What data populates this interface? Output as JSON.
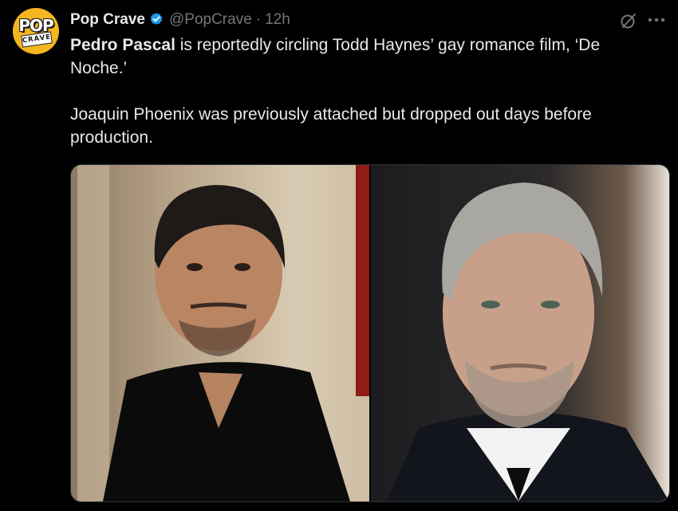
{
  "account": {
    "display_name": "Pop Crave",
    "handle": "@PopCrave",
    "separator": "·",
    "time": "12h",
    "avatar_text_top": "POP",
    "avatar_text_bottom": "CRAVE",
    "avatar_color": "#f3b61f",
    "verified_badge_color": "#1d9bf0"
  },
  "tweet": {
    "bold_name": "Pedro Pascal",
    "line1_rest": " is reportedly circling Todd Haynes’ gay romance film, ‘De Noche.’",
    "line2": "Joaquin Phoenix was previously attached but dropped out days before production."
  },
  "icons": {
    "verified": "verified-badge-icon",
    "grok": "grok-icon",
    "more": "more-options-icon"
  },
  "media": {
    "photo_count": 2
  }
}
